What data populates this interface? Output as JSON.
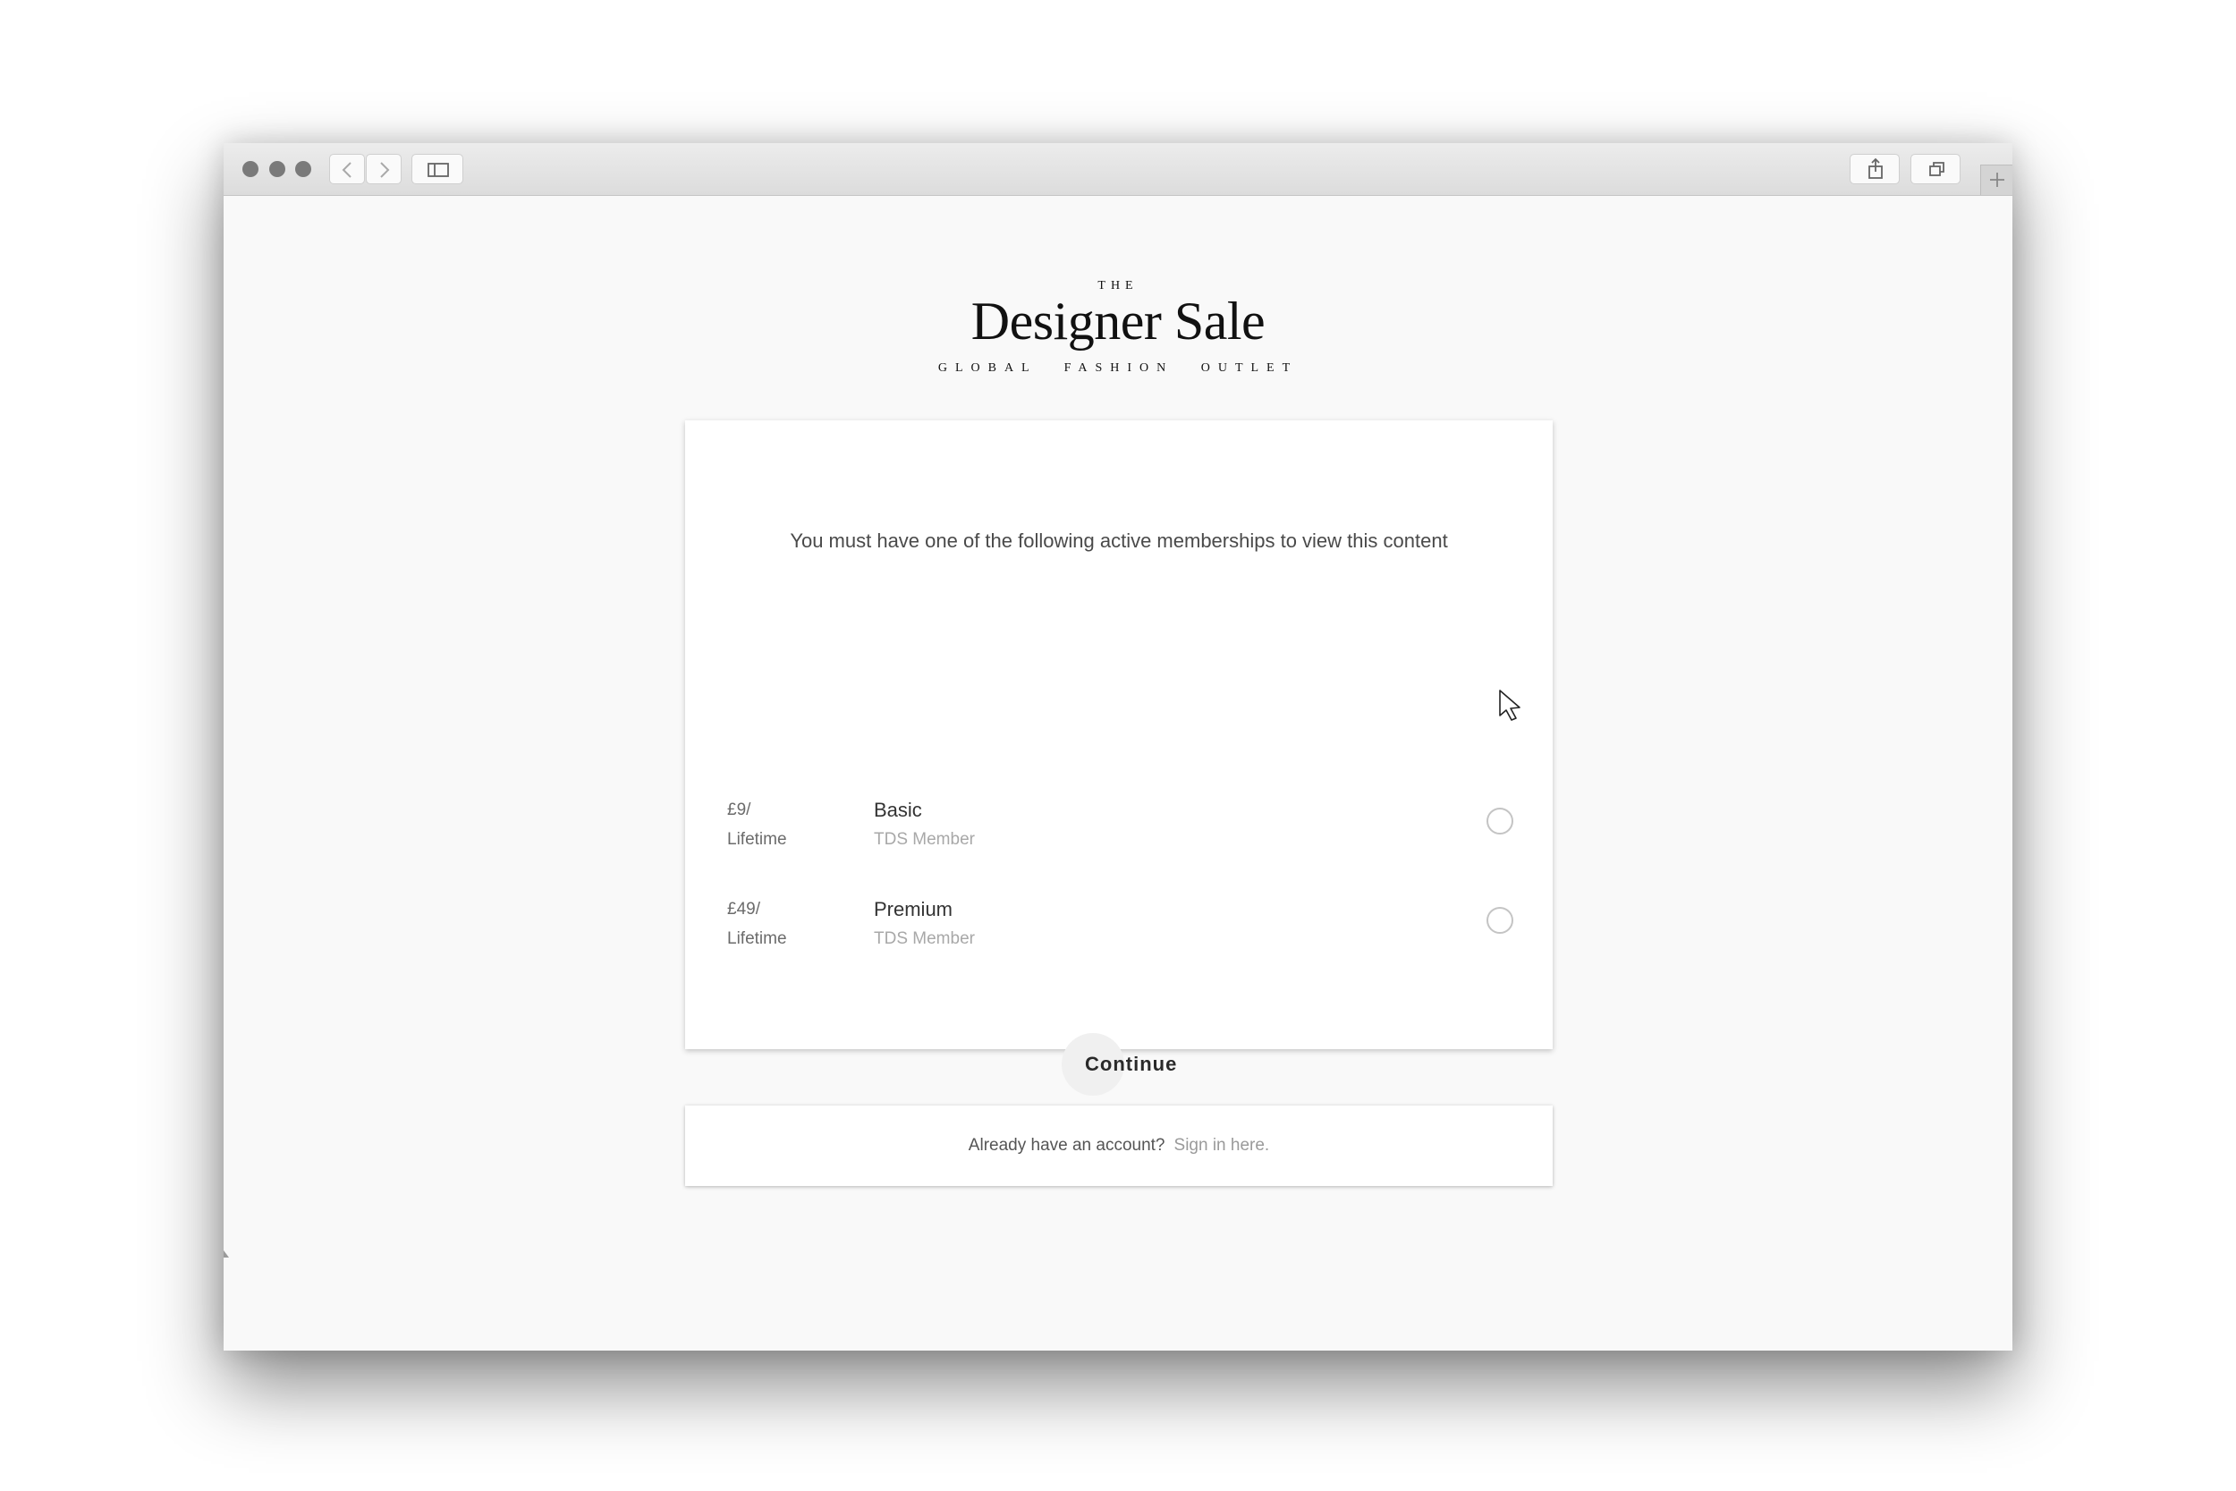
{
  "browser": {
    "toolbar_icons": [
      "close-dot",
      "minimize-dot",
      "zoom-dot",
      "chevron-left-icon",
      "chevron-right-icon",
      "sidebar-icon",
      "share-icon",
      "tabs-icon",
      "plus-icon"
    ]
  },
  "logo": {
    "the": "THE",
    "name": "Designer Sale",
    "tagline": "GLOBAL FASHION OUTLET"
  },
  "membership": {
    "notice": "You must have one of the following active memberships to view this content",
    "plans": [
      {
        "price": "£9/",
        "period": "Lifetime",
        "name": "Basic",
        "type": "TDS Member",
        "selected": false
      },
      {
        "price": "£49/",
        "period": "Lifetime",
        "name": "Premium",
        "type": "TDS Member",
        "selected": false
      }
    ],
    "continue_label": "Continue"
  },
  "signin": {
    "question": "Already have an account?",
    "link_label": "Sign in here."
  },
  "colors": {
    "page_background": "#f9f9f9",
    "card_background": "#ffffff",
    "text_primary": "#333333",
    "text_muted": "#a8a8a8",
    "radio_border": "#c4c4c4"
  }
}
